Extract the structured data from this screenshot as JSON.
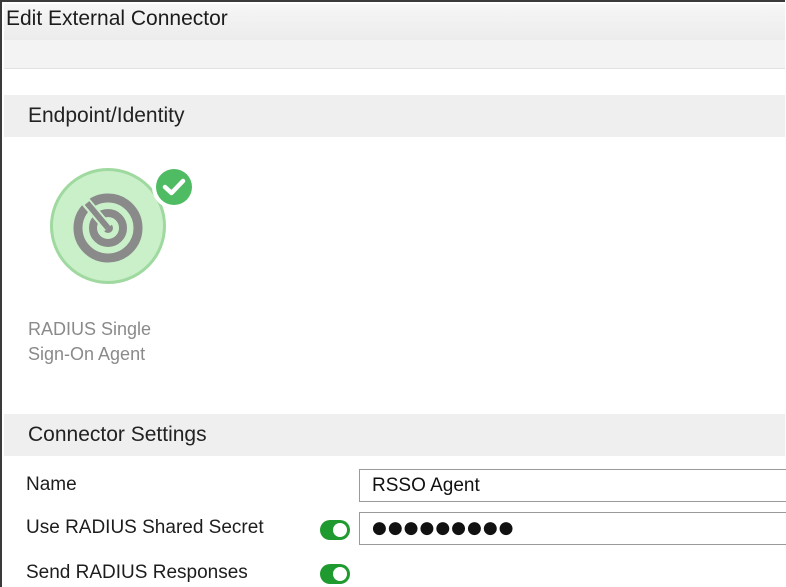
{
  "window": {
    "title": "Edit External Connector"
  },
  "sections": {
    "endpoint": {
      "title": "Endpoint/Identity"
    },
    "settings": {
      "title": "Connector Settings"
    }
  },
  "connector": {
    "label_line1": "RADIUS Single",
    "label_line2": "Sign-On Agent",
    "icon": "radar-icon",
    "selected": true,
    "status_icon": "check-icon"
  },
  "fields": {
    "name": {
      "label": "Name",
      "value": "RSSO Agent"
    },
    "shared_secret": {
      "label": "Use RADIUS Shared Secret",
      "enabled": true,
      "value": "●●●●●●●●●"
    },
    "send_responses": {
      "label": "Send RADIUS Responses",
      "enabled": true
    }
  },
  "colors": {
    "accent_green": "#1f9a2f",
    "badge_green": "#4fbb63",
    "tile_fill": "#c9f0c9",
    "section_header_bg": "#efefef"
  }
}
